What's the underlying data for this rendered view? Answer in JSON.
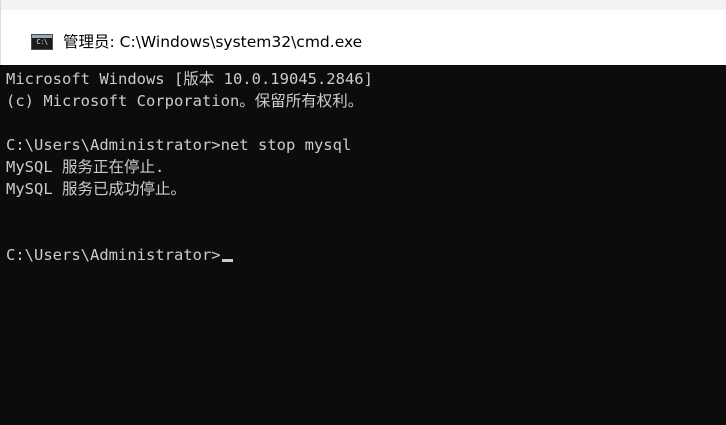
{
  "window": {
    "title": "管理员: C:\\Windows\\system32\\cmd.exe",
    "icon": "cmd-icon",
    "icon_label": "C:\\"
  },
  "console": {
    "lines": [
      "Microsoft Windows [版本 10.0.19045.2846]",
      "(c) Microsoft Corporation。保留所有权利。",
      "",
      "C:\\Users\\Administrator>net stop mysql",
      "MySQL 服务正在停止.",
      "MySQL 服务已成功停止。",
      "",
      "",
      "C:\\Users\\Administrator>"
    ]
  },
  "colors": {
    "console_background": "#0c0c0c",
    "console_text": "#cccccc",
    "titlebar_background": "#ffffff"
  }
}
